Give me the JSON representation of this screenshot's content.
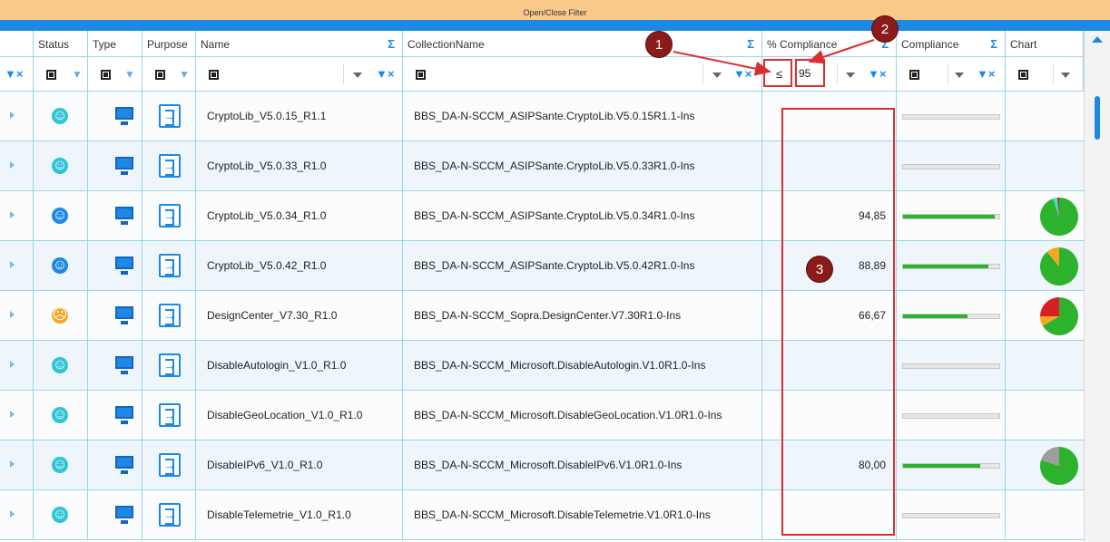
{
  "toolbar": {
    "filter_toggle_label": "Open/Close Filter",
    "tick_mark": "1"
  },
  "columns": {
    "status": "Status",
    "type": "Type",
    "purpose": "Purpose",
    "name": "Name",
    "collection": "CollectionName",
    "pct_compliance": "% Compliance",
    "compliance": "Compliance",
    "chart": "Chart"
  },
  "icons": {
    "sigma": "Σ",
    "le_operator": "≤"
  },
  "filter": {
    "compliance_operator": "≤",
    "compliance_value": "95"
  },
  "rows": [
    {
      "name": "CryptoLib_V5.0.15_R1.1",
      "collection": "BBS_DA-N-SCCM_ASIPSante.CryptoLib.V5.0.15R1.1-Ins",
      "status": "smile",
      "pct": "",
      "bar_fraction": 0
    },
    {
      "name": "CryptoLib_V5.0.33_R1.0",
      "collection": "BBS_DA-N-SCCM_ASIPSante.CryptoLib.V5.0.33R1.0-Ins",
      "status": "smile",
      "pct": "",
      "bar_fraction": 0
    },
    {
      "name": "CryptoLib_V5.0.34_R1.0",
      "collection": "BBS_DA-N-SCCM_ASIPSante.CryptoLib.V5.0.34R1.0-Ins",
      "status": "cool",
      "pct": "94,85",
      "bar_fraction": 0.9485
    },
    {
      "name": "CryptoLib_V5.0.42_R1.0",
      "collection": "BBS_DA-N-SCCM_ASIPSante.CryptoLib.V5.0.42R1.0-Ins",
      "status": "cool",
      "pct": "88,89",
      "bar_fraction": 0.8889
    },
    {
      "name": "DesignCenter_V7.30_R1.0",
      "collection": "BBS_DA-N-SCCM_Sopra.DesignCenter.V7.30R1.0-Ins",
      "status": "meh",
      "pct": "66,67",
      "bar_fraction": 0.6667
    },
    {
      "name": "DisableAutologin_V1.0_R1.0",
      "collection": "BBS_DA-N-SCCM_Microsoft.DisableAutologin.V1.0R1.0-Ins",
      "status": "smile",
      "pct": "",
      "bar_fraction": 0
    },
    {
      "name": "DisableGeoLocation_V1.0_R1.0",
      "collection": "BBS_DA-N-SCCM_Microsoft.DisableGeoLocation.V1.0R1.0-Ins",
      "status": "smile",
      "pct": "",
      "bar_fraction": 0
    },
    {
      "name": "DisableIPv6_V1.0_R1.0",
      "collection": "BBS_DA-N-SCCM_Microsoft.DisableIPv6.V1.0R1.0-Ins",
      "status": "smile",
      "pct": "80,00",
      "bar_fraction": 0.8
    },
    {
      "name": "DisableTelemetrie_V1.0_R1.0",
      "collection": "BBS_DA-N-SCCM_Microsoft.DisableTelemetrie.V1.0R1.0-Ins",
      "status": "smile",
      "pct": "",
      "bar_fraction": 0
    }
  ],
  "pies": [
    {
      "row": 2,
      "slices": [
        {
          "value": 94.85,
          "color": "#2db22d"
        },
        {
          "value": 3.5,
          "color": "#2ee6d6"
        },
        {
          "value": 1.65,
          "color": "#d62020"
        }
      ]
    },
    {
      "row": 3,
      "slices": [
        {
          "value": 88.89,
          "color": "#2db22d"
        },
        {
          "value": 11.11,
          "color": "#f5a623"
        }
      ]
    },
    {
      "row": 4,
      "slices": [
        {
          "value": 66.67,
          "color": "#2db22d"
        },
        {
          "value": 8.33,
          "color": "#f5a623"
        },
        {
          "value": 25.0,
          "color": "#d62020"
        }
      ]
    },
    {
      "row": 7,
      "slices": [
        {
          "value": 80.0,
          "color": "#2db22d"
        },
        {
          "value": 20.0,
          "color": "#9e9e9e"
        }
      ]
    }
  ],
  "annotations": [
    {
      "label": "1"
    },
    {
      "label": "2"
    },
    {
      "label": "3"
    }
  ],
  "colors": {
    "accent": "#1e88e5",
    "topbar": "#f9c98a",
    "annotation": "#d9302f",
    "badge": "#8b1a1a",
    "bar_fill": "#2db22d"
  }
}
